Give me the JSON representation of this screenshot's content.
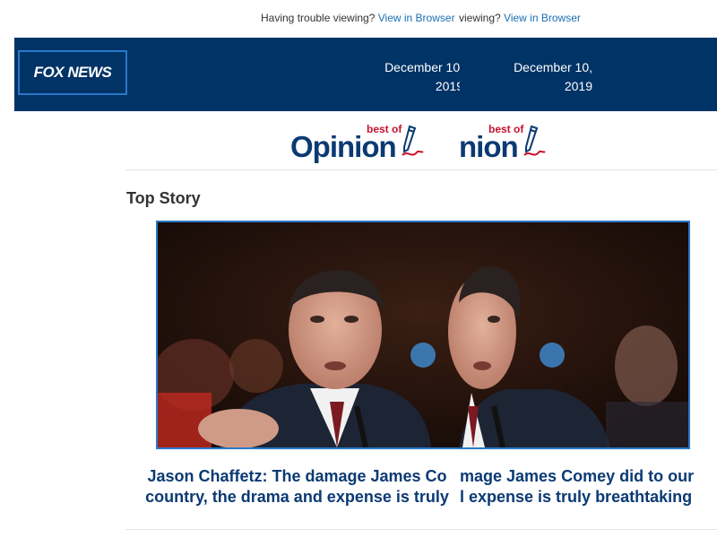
{
  "topbar": {
    "trouble_text": "Having trouble viewing?",
    "view_link": "View in Browser",
    "trouble_text_fragment": "viewing?",
    "view_link_repeat": "View in Browser"
  },
  "header": {
    "logo": "FOX NEWS",
    "date_line1": "December 10,",
    "date_line2": "2019"
  },
  "banner": {
    "best_of": "best of",
    "opinion_word": "Opinion"
  },
  "section": {
    "title": "Top Story"
  },
  "story": {
    "headline_left_line1": "Jason Chaffetz: The damage James Co",
    "headline_left_line2": "country, the drama and expense is truly",
    "headline_right_line1": "mage James Comey did to our",
    "headline_right_line2": "l expense is truly breathtaking"
  },
  "colors": {
    "header_bg": "#003366",
    "accent_border": "#2b78c9",
    "headline": "#0b3a73",
    "link": "#1a6fb3",
    "best_of_red": "#c8102e"
  },
  "icons": [
    "pen-icon",
    "fox-news-logo"
  ]
}
